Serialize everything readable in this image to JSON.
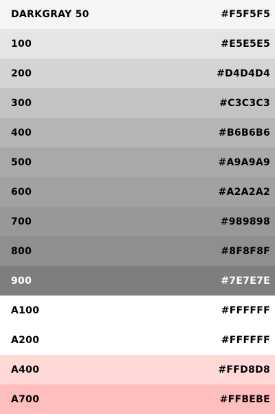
{
  "palette": {
    "swatches": [
      {
        "name": "DARKGRAY 50",
        "hex": "#F5F5F5",
        "color": "#F5F5F5",
        "text_color": "#000000"
      },
      {
        "name": "100",
        "hex": "#E5E5E5",
        "color": "#E5E5E5",
        "text_color": "#000000"
      },
      {
        "name": "200",
        "hex": "#D4D4D4",
        "color": "#D4D4D4",
        "text_color": "#000000"
      },
      {
        "name": "300",
        "hex": "#C3C3C3",
        "color": "#C3C3C3",
        "text_color": "#000000"
      },
      {
        "name": "400",
        "hex": "#B6B6B6",
        "color": "#B6B6B6",
        "text_color": "#000000"
      },
      {
        "name": "500",
        "hex": "#A9A9A9",
        "color": "#A9A9A9",
        "text_color": "#000000"
      },
      {
        "name": "600",
        "hex": "#A2A2A2",
        "color": "#A2A2A2",
        "text_color": "#000000"
      },
      {
        "name": "700",
        "hex": "#989898",
        "color": "#989898",
        "text_color": "#000000"
      },
      {
        "name": "800",
        "hex": "#8F8F8F",
        "color": "#8F8F8F",
        "text_color": "#000000"
      },
      {
        "name": "900",
        "hex": "#7E7E7E",
        "color": "#7E7E7E",
        "text_color": "#FFFFFF"
      },
      {
        "name": "A100",
        "hex": "#FFFFFF",
        "color": "#FFFFFF",
        "text_color": "#000000"
      },
      {
        "name": "A200",
        "hex": "#FFFFFF",
        "color": "#FFFFFF",
        "text_color": "#000000"
      },
      {
        "name": "A400",
        "hex": "#FFD8D8",
        "color": "#FFD8D8",
        "text_color": "#000000"
      },
      {
        "name": "A700",
        "hex": "#FFBEBE",
        "color": "#FFBEBE",
        "text_color": "#000000"
      }
    ]
  }
}
